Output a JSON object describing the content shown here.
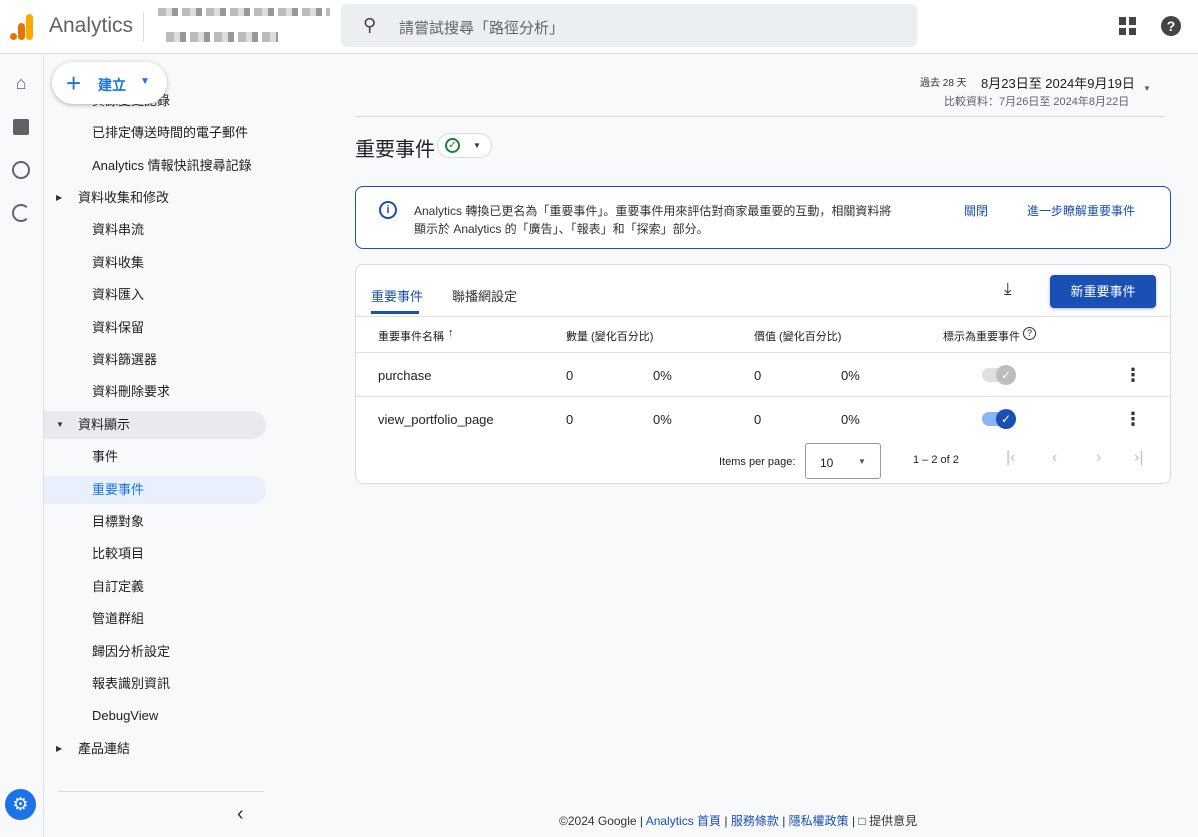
{
  "header": {
    "app_name": "Analytics",
    "search_placeholder": "請嘗試搜尋「路徑分析」"
  },
  "create_button": {
    "label": "建立"
  },
  "sidebar": {
    "items": [
      {
        "label": "資源變更記錄"
      },
      {
        "label": "已排定傳送時間的電子郵件"
      },
      {
        "label": "Analytics 情報快訊搜尋記錄"
      },
      {
        "label": "資料收集和修改",
        "section": true
      },
      {
        "label": "資料串流"
      },
      {
        "label": "資料收集"
      },
      {
        "label": "資料匯入"
      },
      {
        "label": "資料保留"
      },
      {
        "label": "資料篩選器"
      },
      {
        "label": "資料刪除要求"
      },
      {
        "label": "資料顯示",
        "section": true,
        "open": true
      },
      {
        "label": "事件"
      },
      {
        "label": "重要事件",
        "selected": true
      },
      {
        "label": "目標對象"
      },
      {
        "label": "比較項目"
      },
      {
        "label": "自訂定義"
      },
      {
        "label": "管道群組"
      },
      {
        "label": "歸因分析設定"
      },
      {
        "label": "報表識別資訊"
      },
      {
        "label": "DebugView"
      },
      {
        "label": "產品連結",
        "section": true
      }
    ]
  },
  "date_range": {
    "prefix": "過去 28 天",
    "range": "8月23日至 2024年9月19日",
    "compare": "比較資料：7月26日至 2024年8月22日"
  },
  "page_title": "重要事件",
  "info_banner": {
    "text_line1": "Analytics 轉換已更名為「重要事件」。重要事件用來評估對商家最重要的互動，相關資料將",
    "text_line2": "顯示於 Analytics 的「廣告」、「報表」和「探索」部分。",
    "dismiss": "關閉",
    "learn_more": "進一步瞭解重要事件"
  },
  "tabs": [
    {
      "label": "重要事件",
      "active": true
    },
    {
      "label": "聯播網設定"
    }
  ],
  "new_button": "新重要事件",
  "table": {
    "headers": [
      "重要事件名稱",
      "數量 (變化百分比)",
      "價值 (變化百分比)",
      "標示為重要事件"
    ],
    "rows": [
      {
        "name": "purchase",
        "count": "0",
        "count_change": "0%",
        "value": "0",
        "value_change": "0%",
        "marked": true,
        "locked": true
      },
      {
        "name": "view_portfolio_page",
        "count": "0",
        "count_change": "0%",
        "value": "0",
        "value_change": "0%",
        "marked": true,
        "locked": false
      }
    ]
  },
  "pagination": {
    "items_per_page_label": "Items per page:",
    "items_per_page": "10",
    "range": "1 – 2 of 2"
  },
  "footer": {
    "copyright": "©2024 Google |",
    "home": "Analytics 首頁",
    "terms": "服務條款",
    "privacy": "隱私權政策",
    "sep": "|",
    "feedback": "提供意見"
  },
  "colors": {
    "accent": "#1a73e8",
    "primary_button": "#1a4fb4",
    "logo_orange": "#f9ab00",
    "logo_dark": "#e37400"
  }
}
